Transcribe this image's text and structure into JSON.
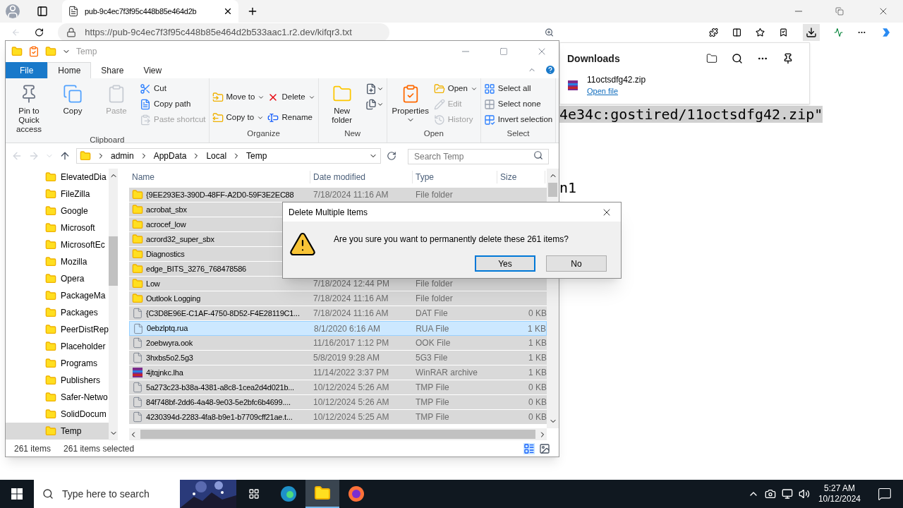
{
  "browser": {
    "tab_title": "pub-9c4ec7f3f95c448b85e464d2b",
    "url": "https://pub-9c4ec7f3f95c448b85e464d2b533aac1.r2.dev/kifqr3.txt",
    "page_lines": [
      "4e34c:gostired/11octsdfg42.zip\"",
      "n1"
    ]
  },
  "downloads": {
    "title": "Downloads",
    "items": [
      {
        "name": "11octsdfg42.zip",
        "action": "Open file"
      }
    ]
  },
  "explorer": {
    "title": "Temp",
    "tabs": [
      {
        "label": "File",
        "kind": "file",
        "selected": false
      },
      {
        "label": "Home",
        "kind": "tab",
        "selected": true
      },
      {
        "label": "Share",
        "kind": "tab",
        "selected": false
      },
      {
        "label": "View",
        "kind": "tab",
        "selected": false
      }
    ],
    "ribbon": [
      {
        "name": "Clipboard",
        "columns": [
          [
            {
              "label": "Pin to Quick access",
              "kind": "large",
              "disabled": false,
              "menu": false
            }
          ],
          [
            {
              "label": "Copy",
              "kind": "large",
              "disabled": false,
              "menu": false
            }
          ],
          [
            {
              "label": "Paste",
              "kind": "large",
              "disabled": true,
              "menu": false
            }
          ],
          [
            {
              "label": "Cut",
              "kind": "small",
              "disabled": false,
              "menu": false
            },
            {
              "label": "Copy path",
              "kind": "small",
              "disabled": false,
              "menu": false
            },
            {
              "label": "Paste shortcut",
              "kind": "small",
              "disabled": true,
              "menu": false
            }
          ]
        ]
      },
      {
        "name": "Organize",
        "columns": [
          [
            {
              "label": "Move to",
              "kind": "medium",
              "disabled": false,
              "menu": true
            },
            {
              "label": "Copy to",
              "kind": "medium",
              "disabled": false,
              "menu": true
            }
          ],
          [
            {
              "label": "Delete",
              "kind": "medium",
              "disabled": false,
              "menu": true
            },
            {
              "label": "Rename",
              "kind": "medium",
              "disabled": false,
              "menu": false
            }
          ]
        ]
      },
      {
        "name": "New",
        "columns": [
          [
            {
              "label": "New folder",
              "kind": "large",
              "disabled": false,
              "menu": false
            }
          ],
          [
            {
              "kind": "icon",
              "disabled": false,
              "menu": true
            },
            {
              "kind": "icon",
              "disabled": false,
              "menu": true
            }
          ]
        ]
      },
      {
        "name": "Open",
        "columns": [
          [
            {
              "label": "Properties",
              "kind": "large",
              "disabled": false,
              "menu": true
            }
          ],
          [
            {
              "label": "Open",
              "kind": "small",
              "disabled": false,
              "menu": true
            },
            {
              "label": "Edit",
              "kind": "small",
              "disabled": true,
              "menu": false
            },
            {
              "label": "History",
              "kind": "small",
              "disabled": true,
              "menu": false
            }
          ]
        ]
      },
      {
        "name": "Select",
        "columns": [
          [
            {
              "label": "Select all",
              "kind": "small",
              "disabled": false,
              "menu": false
            },
            {
              "label": "Select none",
              "kind": "small",
              "disabled": false,
              "menu": false
            },
            {
              "label": "Invert selection",
              "kind": "small",
              "disabled": false,
              "menu": false
            }
          ]
        ]
      }
    ],
    "breadcrumb": [
      "admin",
      "AppData",
      "Local",
      "Temp"
    ],
    "search": {
      "placeholder": "Search Temp"
    },
    "nav": [
      {
        "label": "ElevatedDia",
        "selected": false
      },
      {
        "label": "FileZilla",
        "selected": false
      },
      {
        "label": "Google",
        "selected": false
      },
      {
        "label": "Microsoft",
        "selected": false
      },
      {
        "label": "MicrosoftEc",
        "selected": false
      },
      {
        "label": "Mozilla",
        "selected": false
      },
      {
        "label": "Opera",
        "selected": false
      },
      {
        "label": "PackageMa",
        "selected": false
      },
      {
        "label": "Packages",
        "selected": false
      },
      {
        "label": "PeerDistRep",
        "selected": false
      },
      {
        "label": "Placeholder",
        "selected": false
      },
      {
        "label": "Programs",
        "selected": false
      },
      {
        "label": "Publishers",
        "selected": false
      },
      {
        "label": "Safer-Netwo",
        "selected": false
      },
      {
        "label": "SolidDocum",
        "selected": false
      },
      {
        "label": "Temp",
        "selected": true
      }
    ],
    "columns": [
      "Name",
      "Date modified",
      "Type",
      "Size"
    ],
    "rows": [
      {
        "name": "{9EE293E3-390D-48FF-A2D0-59F3E2EC88",
        "date": "7/18/2024 11:16 AM",
        "type": "File folder",
        "kind": "folder",
        "selected": true,
        "focused": false
      },
      {
        "name": "acrobat_sbx",
        "kind": "folder",
        "selected": true,
        "focused": false
      },
      {
        "name": "acrocef_low",
        "kind": "folder",
        "selected": true,
        "focused": false
      },
      {
        "name": "acrord32_super_sbx",
        "kind": "folder",
        "selected": true,
        "focused": false
      },
      {
        "name": "Diagnostics",
        "kind": "folder",
        "selected": true,
        "focused": false
      },
      {
        "name": "edge_BITS_3276_768478586",
        "kind": "folder",
        "selected": true,
        "focused": false
      },
      {
        "name": "Low",
        "date": "7/18/2024 12:44 PM",
        "type": "File folder",
        "kind": "folder",
        "selected": true,
        "focused": false
      },
      {
        "name": "Outlook Logging",
        "date": "7/18/2024 11:16 AM",
        "type": "File folder",
        "kind": "folder",
        "selected": true,
        "focused": false
      },
      {
        "name": "{C3D8E96E-C1AF-4750-8D52-F4E28119C1...",
        "date": "7/18/2024 11:16 AM",
        "type": "DAT File",
        "size": "0 KB",
        "kind": "file",
        "selected": true,
        "focused": false
      },
      {
        "name": "0ebzlptq.rua",
        "date": "8/1/2020 6:16 AM",
        "type": "RUA File",
        "size": "1 KB",
        "kind": "file",
        "selected": true,
        "focused": true
      },
      {
        "name": "2oebwyra.ook",
        "date": "11/16/2017 1:12 PM",
        "type": "OOK File",
        "size": "1 KB",
        "kind": "file",
        "selected": true,
        "focused": false
      },
      {
        "name": "3hxbs5o2.5g3",
        "date": "5/8/2019 9:28 AM",
        "type": "5G3 File",
        "size": "1 KB",
        "kind": "file",
        "selected": true,
        "focused": false
      },
      {
        "name": "4jtqjnkc.lha",
        "date": "11/14/2022 3:37 PM",
        "type": "WinRAR archive",
        "size": "1 KB",
        "kind": "archive",
        "selected": true,
        "focused": false
      },
      {
        "name": "5a273c23-b38a-4381-a8c8-1cea2d4d021b...",
        "date": "10/12/2024 5:26 AM",
        "type": "TMP File",
        "size": "0 KB",
        "kind": "file",
        "selected": true,
        "focused": false
      },
      {
        "name": "84f748bf-2dd6-4a48-9e03-5e2bfc6b4699....",
        "date": "10/12/2024 5:26 AM",
        "type": "TMP File",
        "size": "0 KB",
        "kind": "file",
        "selected": true,
        "focused": false
      },
      {
        "name": "4230394d-2283-4fa8-b9e1-b7709cff21ae.t...",
        "date": "10/12/2024 5:25 AM",
        "type": "TMP File",
        "size": "0 KB",
        "kind": "file",
        "selected": true,
        "focused": false
      }
    ],
    "status": {
      "count": "261 items",
      "selection": "261 items selected"
    }
  },
  "dialog": {
    "title": "Delete Multiple Items",
    "message": "Are you sure you want to permanently delete these 261 items?",
    "buttons": [
      {
        "label": "Yes",
        "default": true
      },
      {
        "label": "No",
        "default": false
      }
    ]
  },
  "taskbar": {
    "search": {
      "placeholder": "Type here to search"
    },
    "apps": [
      {
        "kind": "edge",
        "selected": false
      },
      {
        "kind": "explorer",
        "selected": true
      },
      {
        "kind": "firefox",
        "selected": false
      }
    ],
    "time": "5:27 AM",
    "date": "10/12/2024"
  }
}
